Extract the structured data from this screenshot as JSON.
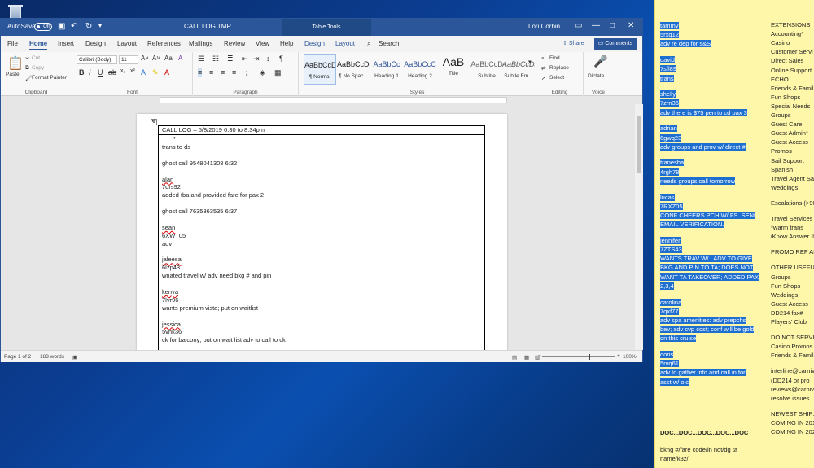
{
  "desktop": {
    "recycle_bin_icon": "recycle-bin-icon"
  },
  "word": {
    "autosave_label": "AutoSave",
    "autosave_state": "Off",
    "doc_title": "CALL LOG TMP",
    "table_tools": "Table Tools",
    "user_name": "Lori Corbin",
    "tabs": [
      "File",
      "Home",
      "Insert",
      "Design",
      "Layout",
      "References",
      "Mailings",
      "Review",
      "View",
      "Help",
      "Design",
      "Layout"
    ],
    "search_label": "Search",
    "share_label": "Share",
    "comments_label": "Comments",
    "clipboard": {
      "paste": "Paste",
      "cut": "Cut",
      "copy": "Copy",
      "format_painter": "Format Painter",
      "label": "Clipboard"
    },
    "font": {
      "name": "Calibri (Body)",
      "size": "11",
      "label": "Font"
    },
    "paragraph_label": "Paragraph",
    "styles": [
      {
        "preview": "AaBbCcDc",
        "name": "¶ Normal"
      },
      {
        "preview": "AaBbCcDc",
        "name": "¶ No Spac..."
      },
      {
        "preview": "AaBbCc",
        "name": "Heading 1"
      },
      {
        "preview": "AaBbCcC",
        "name": "Heading 2"
      },
      {
        "preview": "AaB",
        "name": "Title"
      },
      {
        "preview": "AaBbCcD",
        "name": "Subtitle"
      },
      {
        "preview": "AaBbCcDi",
        "name": "Subtle Em..."
      }
    ],
    "styles_label": "Styles",
    "editing": {
      "find": "Find",
      "replace": "Replace",
      "select": "Select",
      "label": "Editing"
    },
    "voice": {
      "dictate": "Dictate",
      "label": "Voice"
    },
    "document": {
      "header": "CALL LOG – 5/8/2019  6:30 to 8:34pm",
      "bullet": "•",
      "lines": [
        "trans to ds",
        "",
        "ghost call 9548041308 6:32",
        "",
        "alan",
        "7drs92",
        "added tba and provided fare for pax 2",
        "",
        "ghost call 7635363535 6:37",
        "",
        "sean",
        "6XWT05",
        "adv",
        "",
        "jaleesa",
        "6lzp43",
        "wnated travel w/ adv need bkg # and pin",
        "",
        "kenya",
        "7lvr96",
        "wants premium vista; put on waitlist",
        "",
        "jessica",
        "5vhk36",
        "ck for balcony; put on wait list adv to call to ck"
      ]
    },
    "status": {
      "page": "Page 1 of 2",
      "words": "183 words",
      "zoom": "100%"
    }
  },
  "note_left": {
    "highlighted": [
      "tammy",
      "5rxq12",
      "adv re dep for s&S",
      "",
      "david",
      "7sfl89",
      "trans",
      "",
      "shelly",
      "7zrn36",
      "adv there is $75 pen to cd pax 3",
      "",
      "adrian",
      "6gwq23",
      "adv groups and prov w/ direct #",
      "",
      "tranesha",
      "4rgh78",
      "needs groups call tomorrow",
      "",
      "lucas",
      "7RXZ05",
      "CONF CHEERS PCH W/ FS. SENt",
      "EMAIL VERIFICATION.",
      "",
      "jennifer",
      "7ZTS43",
      "WANTS TRAV W/ , ADV TO GIVE",
      "BKG AND PIN TO TA; DOES NOT",
      "WANT TA TAKEOVER; ADDED PAX",
      "2,3,4",
      "",
      "carolina",
      "7qxf77",
      "adv spa amenities: adv prepchs",
      "bev; adv cvp cost; conf will be gold",
      "on this cruise",
      "",
      "doris",
      "5rvq61",
      "adv to gather info and call in for",
      "asst w/ olc"
    ],
    "plain": [
      "DOC...DOC...DOC...DOC...DOC",
      "",
      "bkng #/fare code/in not/dg ta",
      "name/k3z/"
    ]
  },
  "note_right": {
    "lines": [
      "EXTENSIONS",
      "Accounting*",
      "Casino",
      "Customer Servi",
      "Direct Sales",
      "Online Support",
      "ECHO",
      "Friends & Famil",
      "Fun Shops",
      "Special Needs",
      "Groups",
      "Guest Care",
      "Guest Admin*",
      "Guest Access",
      "Promos",
      "Sail Support",
      "Spanish",
      "Travel Agent Sa",
      "Weddings",
      "",
      "Escalations (>90",
      "",
      "Travel Services (",
      "    *warm trans",
      "iKnow Answer Il",
      "",
      "PROMO REF AID",
      "",
      "OTHER USEFUL",
      "Groups",
      "Fun Shops",
      "Weddings",
      "Guest Access",
      "DD214 fax#",
      "Players' Club",
      "",
      "DO NOT SERVIC",
      "Casino Promos",
      "Friends & Famil",
      "",
      "interline@carniv",
      "    (DD214 or pro",
      "reviews@carniv",
      "    resolve issues",
      "",
      "NEWEST SHIP:",
      "COMING IN 201",
      "COMING IN 202"
    ]
  }
}
